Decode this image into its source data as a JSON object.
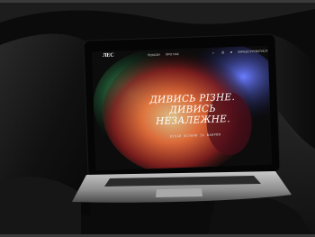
{
  "site": {
    "logo": "ЛЕС",
    "nav": [
      "ПОКАЗИ",
      "ПРО НАС"
    ],
    "cta": "ЗАРЕЄСТРУВАТИСЯ"
  },
  "hero": {
    "line1": "ДИВИСЬ РІЗНЕ.",
    "line2": "ДИВИСЬ",
    "line3": "НЕЗАЛЕЖНЕ.",
    "subline": "ШУКАЙ ФІЛЬМИ ЗА ЖАНРОМ"
  },
  "colors": {
    "background": "#0a0a0a",
    "screen": "#0c0c0c",
    "text": "#ffffff"
  },
  "icons": [
    "search-icon",
    "globe-icon",
    "user-icon"
  ]
}
